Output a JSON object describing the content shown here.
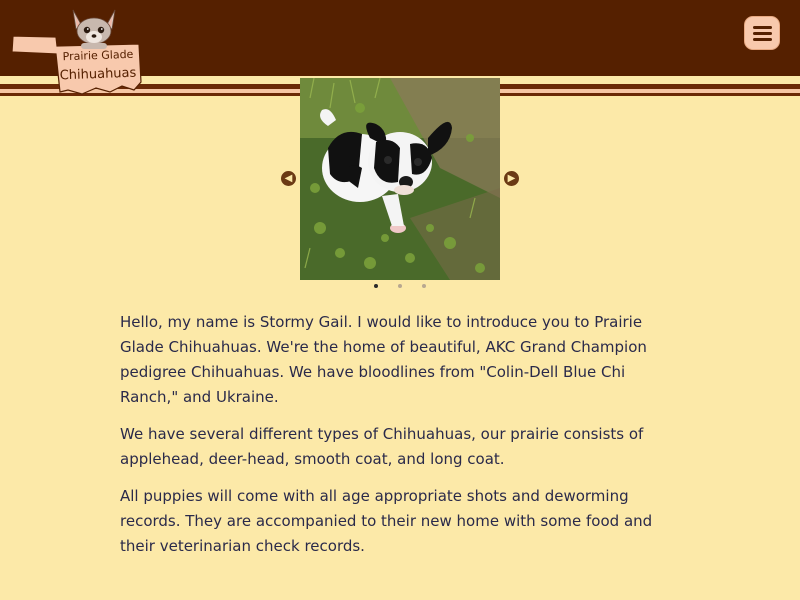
{
  "logo": {
    "line1": "Prairie Glade",
    "line2": "Chihuahuas",
    "icon": "chihuahua-head-icon"
  },
  "header": {
    "menu_icon": "hamburger-menu-icon"
  },
  "carousel": {
    "image_alt": "Black and white long coat Chihuahua puppy sitting in grass",
    "prev_icon": "chevron-left-icon",
    "next_icon": "chevron-right-icon",
    "slide_count": 3,
    "active_slide": 1
  },
  "content": {
    "paragraphs": [
      "Hello, my name is Stormy Gail. I would like to introduce you to Prairie Glade Chihuahuas. We're the home of beautiful, AKC Grand Champion pedigree Chihuahuas. We have bloodlines from \"Colin-Dell Blue Chi Ranch,\" and Ukraine.",
      "We have several different types of Chihuahuas, our prairie consists of applehead, deer-head, smooth coat, and long coat.",
      "All puppies will come with all age appropriate shots and deworming records. They are accompanied to their new home with some food and their veterinarian check records."
    ]
  },
  "colors": {
    "header": "#552000",
    "background": "#fce9a8",
    "accent": "#f8c9ad",
    "text": "#2a2a4a"
  }
}
